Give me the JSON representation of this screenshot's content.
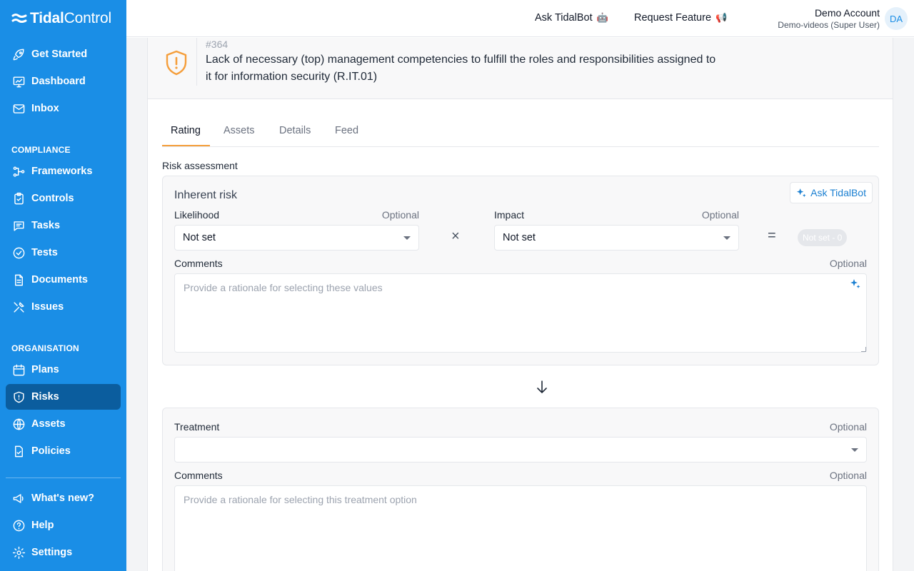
{
  "brand": {
    "name_bold": "Tidal",
    "name_light": "Control"
  },
  "sidebar": {
    "top_items": [
      {
        "label": "Get Started",
        "icon": "rocket-icon"
      },
      {
        "label": "Dashboard",
        "icon": "chart-icon"
      },
      {
        "label": "Inbox",
        "icon": "mail-icon"
      }
    ],
    "compliance_label": "COMPLIANCE",
    "compliance_items": [
      {
        "label": "Frameworks",
        "icon": "flow-icon"
      },
      {
        "label": "Controls",
        "icon": "clipboard-icon"
      },
      {
        "label": "Tasks",
        "icon": "chat-icon"
      },
      {
        "label": "Tests",
        "icon": "check-circle-icon"
      },
      {
        "label": "Documents",
        "icon": "document-icon"
      },
      {
        "label": "Issues",
        "icon": "tools-icon"
      }
    ],
    "organisation_label": "ORGANISATION",
    "organisation_items": [
      {
        "label": "Plans",
        "icon": "calendar-icon"
      },
      {
        "label": "Risks",
        "icon": "shield-icon",
        "active": true
      },
      {
        "label": "Assets",
        "icon": "globe-icon"
      },
      {
        "label": "Policies",
        "icon": "policy-icon"
      }
    ],
    "bottom_items": [
      {
        "label": "What's new?",
        "icon": "megaphone-icon"
      },
      {
        "label": "Help",
        "icon": "help-icon"
      },
      {
        "label": "Settings",
        "icon": "gear-icon"
      }
    ]
  },
  "topbar": {
    "ask_label": "Ask TidalBot",
    "ask_emoji": "🤖",
    "request_label": "Request Feature",
    "request_emoji": "📢",
    "account_name": "Demo Account",
    "account_sub": "Demo-videos (Super User)",
    "avatar_initials": "DA"
  },
  "risk": {
    "id": "#364",
    "title": "Lack of necessary (top) management competencies to fulfill the roles and responsibilities assigned to it for information security (R.IT.01)"
  },
  "tabs": [
    "Rating",
    "Assets",
    "Details",
    "Feed"
  ],
  "active_tab": "Rating",
  "assessment": {
    "section_title": "Risk assessment",
    "inherent_title": "Inherent risk",
    "ask_button": "Ask TidalBot",
    "likelihood_label": "Likelihood",
    "likelihood_optional": "Optional",
    "likelihood_value": "Not set",
    "impact_label": "Impact",
    "impact_optional": "Optional",
    "impact_value": "Not set",
    "times_symbol": "×",
    "equals_symbol": "=",
    "score": "Not set - 0",
    "comments_label": "Comments",
    "comments_optional": "Optional",
    "comments_placeholder": "Provide a rationale for selecting these values"
  },
  "treatment": {
    "label": "Treatment",
    "optional": "Optional",
    "value": "",
    "comments_label": "Comments",
    "comments_optional": "Optional",
    "comments_placeholder": "Provide a rationale for selecting this treatment option"
  },
  "colors": {
    "sidebar": "#1a8ee6",
    "active_nav": "#0b5d9e",
    "accent_tab": "#f59e3b",
    "shield": "#f59e3b",
    "link": "#1a7fd1"
  }
}
